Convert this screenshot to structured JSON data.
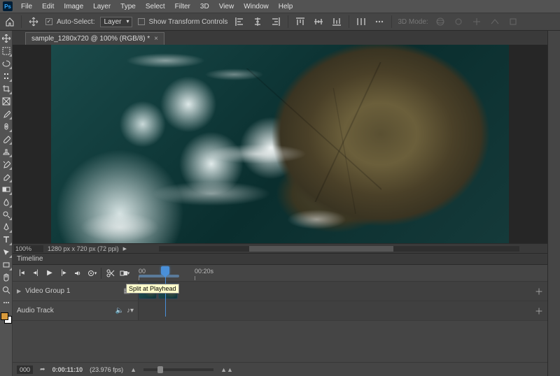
{
  "menu": [
    "File",
    "Edit",
    "Image",
    "Layer",
    "Type",
    "Select",
    "Filter",
    "3D",
    "View",
    "Window",
    "Help"
  ],
  "options": {
    "auto_select_label": "Auto-Select:",
    "auto_select_checked": true,
    "layer_dropdown": "Layer",
    "show_transform_label": "Show Transform Controls",
    "show_transform_checked": false,
    "threeD_label": "3D Mode:"
  },
  "doc": {
    "tab_title": "sample_1280x720 @ 100% (RGB/8) *"
  },
  "status": {
    "zoom": "100%",
    "info": "1280 px x 720 px (72 ppi)"
  },
  "timeline": {
    "panel_title": "Timeline",
    "ruler": {
      "t0": "00",
      "t1": "00:20s"
    },
    "tooltip": "Split at Playhead",
    "video_group_label": "Video Group 1",
    "audio_track_label": "Audio Track",
    "footer": {
      "counter": "000",
      "time": "0:00:11:10",
      "fps": "(23.976 fps)"
    }
  },
  "colors": {
    "fg": "#d89a3c",
    "bg": "#ffffff"
  }
}
